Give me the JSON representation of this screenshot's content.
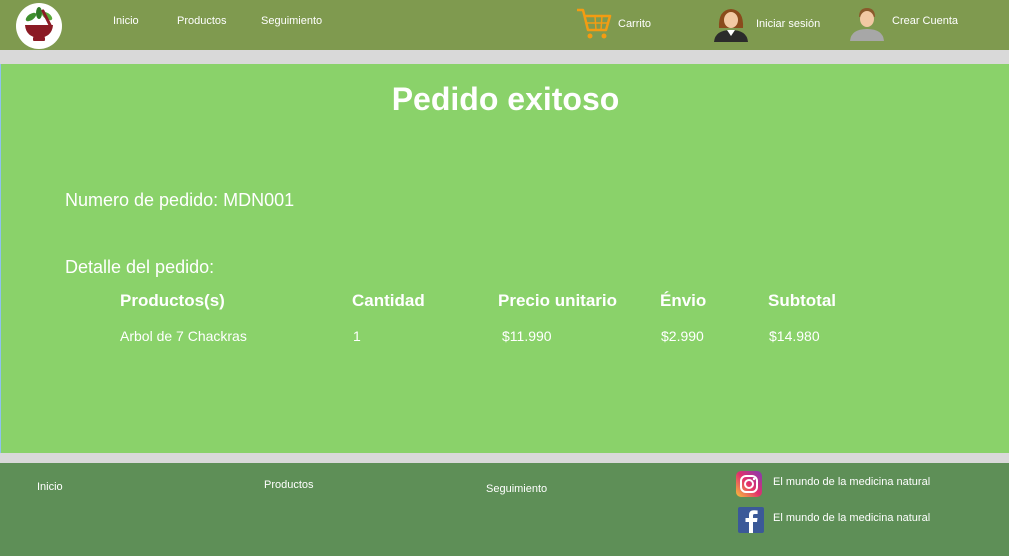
{
  "header": {
    "nav": [
      {
        "label": "Inicio"
      },
      {
        "label": "Productos"
      },
      {
        "label": "Seguimiento"
      }
    ],
    "cart_label": "Carrito",
    "login_label": "Iniciar sesión",
    "register_label": "Crear Cuenta"
  },
  "main": {
    "title": "Pedido exitoso",
    "order_number": "Numero de pedido: MDN001",
    "detail_label": "Detalle del pedido:",
    "table": {
      "headers": [
        "Productos(s)",
        "Cantidad",
        "Precio unitario",
        "Énvio",
        "Subtotal"
      ],
      "rows": [
        [
          "Arbol de 7 Chackras",
          "1",
          "$11.990",
          "$2.990",
          "$14.980"
        ]
      ]
    }
  },
  "footer": {
    "links": [
      {
        "label": "Inicio"
      },
      {
        "label": "Productos"
      },
      {
        "label": "Seguimiento"
      }
    ],
    "instagram_text": "El mundo de la medicina natural",
    "facebook_text": "El mundo de la medicina natural"
  },
  "colors": {
    "header_bg": "#7f9a4f",
    "main_bg": "#8ad26a",
    "footer_bg": "#5e8f57",
    "separator": "#d9d9d9",
    "cart_orange": "#f39c12"
  },
  "icons": {
    "logo": "mortar-herbs-logo",
    "cart": "cart-icon",
    "login": "woman-avatar-icon",
    "register": "man-avatar-icon",
    "instagram": "instagram-icon",
    "facebook": "facebook-icon"
  }
}
